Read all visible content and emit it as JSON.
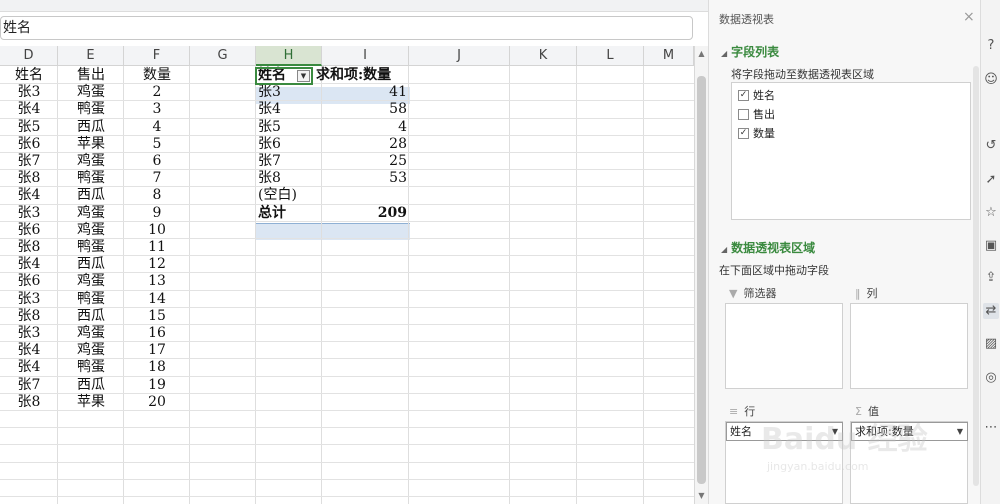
{
  "formula_bar": {
    "value": "姓名"
  },
  "columns": [
    {
      "label": "D"
    },
    {
      "label": "E"
    },
    {
      "label": "F"
    },
    {
      "label": "G"
    },
    {
      "label": "H"
    },
    {
      "label": "I"
    },
    {
      "label": "J"
    },
    {
      "label": "K"
    },
    {
      "label": "L"
    },
    {
      "label": "M"
    }
  ],
  "source_table": {
    "headers": [
      "姓名",
      "售出",
      "数量"
    ],
    "rows": [
      [
        "张3",
        "鸡蛋",
        "2"
      ],
      [
        "张4",
        "鸭蛋",
        "3"
      ],
      [
        "张5",
        "西瓜",
        "4"
      ],
      [
        "张6",
        "苹果",
        "5"
      ],
      [
        "张7",
        "鸡蛋",
        "6"
      ],
      [
        "张8",
        "鸭蛋",
        "7"
      ],
      [
        "张4",
        "西瓜",
        "8"
      ],
      [
        "张3",
        "鸡蛋",
        "9"
      ],
      [
        "张6",
        "鸡蛋",
        "10"
      ],
      [
        "张8",
        "鸭蛋",
        "11"
      ],
      [
        "张4",
        "西瓜",
        "12"
      ],
      [
        "张6",
        "鸡蛋",
        "13"
      ],
      [
        "张3",
        "鸭蛋",
        "14"
      ],
      [
        "张8",
        "西瓜",
        "15"
      ],
      [
        "张3",
        "鸡蛋",
        "16"
      ],
      [
        "张4",
        "鸡蛋",
        "17"
      ],
      [
        "张4",
        "鸭蛋",
        "18"
      ],
      [
        "张7",
        "西瓜",
        "19"
      ],
      [
        "张8",
        "苹果",
        "20"
      ]
    ]
  },
  "pivot": {
    "row_header": "姓名",
    "value_header": "求和项:数量",
    "rows": [
      [
        "张3",
        "41"
      ],
      [
        "张4",
        "58"
      ],
      [
        "张5",
        "4"
      ],
      [
        "张6",
        "28"
      ],
      [
        "张7",
        "25"
      ],
      [
        "张8",
        "53"
      ],
      [
        "(空白)",
        ""
      ]
    ],
    "total_label": "总计",
    "total_value": "209"
  },
  "panel": {
    "title": "数据透视表",
    "close": "×",
    "field_list_title": "字段列表",
    "field_list_hint": "将字段拖动至数据透视表区域",
    "fields": [
      {
        "label": "姓名",
        "checked": true
      },
      {
        "label": "售出",
        "checked": false
      },
      {
        "label": "数量",
        "checked": true
      }
    ],
    "areas_title": "数据透视表区域",
    "areas_hint": "在下面区域中拖动字段",
    "filter_label": "筛选器",
    "columns_label": "列",
    "rows_label": "行",
    "values_label": "值",
    "row_item": "姓名",
    "value_item": "求和项:数量"
  },
  "toolbar": [
    {
      "icon": "help-icon",
      "glyph": "?"
    },
    {
      "icon": "users-icon",
      "glyph": "☺"
    },
    {
      "icon": "history-icon",
      "glyph": "↺"
    },
    {
      "icon": "select-icon",
      "glyph": "➚"
    },
    {
      "icon": "star-icon",
      "glyph": "☆"
    },
    {
      "icon": "template-icon",
      "glyph": "▣"
    },
    {
      "icon": "share-icon",
      "glyph": "⇪"
    },
    {
      "icon": "pivot-icon",
      "glyph": "⇄"
    },
    {
      "icon": "image-icon",
      "glyph": "▨"
    },
    {
      "icon": "shield-icon",
      "glyph": "◎"
    },
    {
      "icon": "more-icon",
      "glyph": "⋯"
    }
  ],
  "watermark": {
    "text": "Baidu 经验",
    "url": "jingyan.baidu.com"
  }
}
